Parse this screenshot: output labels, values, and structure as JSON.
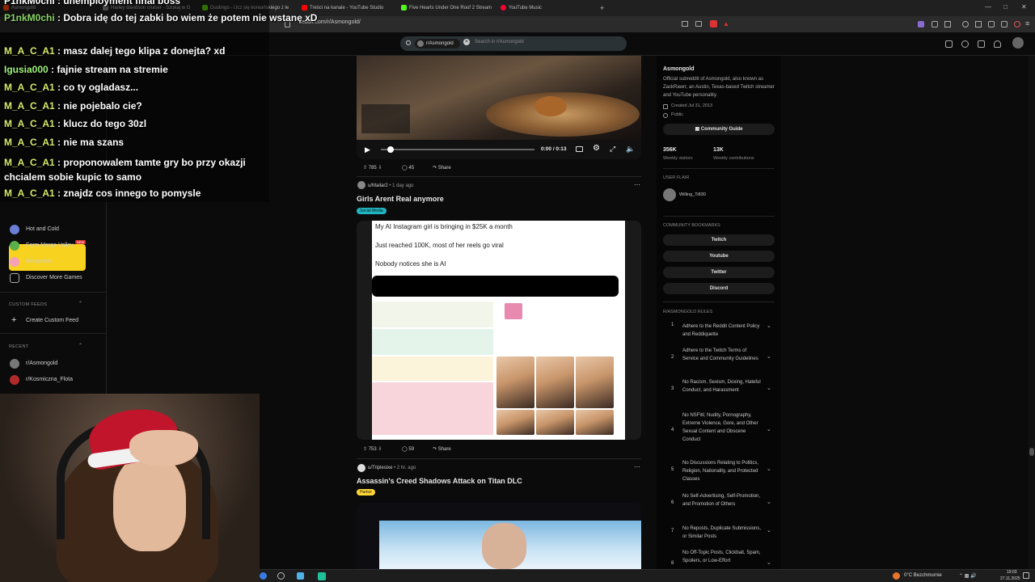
{
  "browser": {
    "tabs": [
      {
        "label": "Asmongold",
        "color": "#ff4500"
      },
      {
        "label": "Harley davidson cruiser - Szukaj w G",
        "color": "#888888"
      },
      {
        "label": "Duolingo - Ucz się koreańskiego z le",
        "color": "#58cc02"
      },
      {
        "label": "Treści na kanale - YouTube Studio",
        "color": "#ff0000"
      },
      {
        "label": "Five Hearts Under One Roof 2 Stream",
        "color": "#53fc18"
      },
      {
        "label": "YouTube Music",
        "color": "#ff0033"
      }
    ],
    "new_tab": "+",
    "url": "reddit.com/r/Asmongold/"
  },
  "search": {
    "chip": "r/Asmongold",
    "placeholder": "Search in r/Asmongold"
  },
  "chat": [
    {
      "user": "P1nkM0chi",
      "message": "Dobra idę do tej zabki bo wiem że potem nie wstanę xD",
      "color": "u1"
    },
    {
      "user": "M_A_C_A1",
      "message": "masz dalej tego klipa z donejta? xd",
      "color": "u2"
    },
    {
      "user": "Igusia000",
      "message": "fajnie stream na stremie",
      "color": "u3"
    },
    {
      "user": "M_A_C_A1",
      "message": "co ty ogladasz...",
      "color": "u2"
    },
    {
      "user": "M_A_C_A1",
      "message": "nie pojebalo cie?",
      "color": "u2"
    },
    {
      "user": "M_A_C_A1",
      "message": "klucz do tego 30zl",
      "color": "u2"
    },
    {
      "user": "M_A_C_A1",
      "message": "nie ma szans",
      "color": "u2"
    },
    {
      "user": "M_A_C_A1",
      "message": "proponowalem tamte gry bo przy okazji chcialem sobie kupic to samo",
      "color": "u2"
    },
    {
      "user": "M_A_C_A1",
      "message": "znajdz cos innego to pomysle",
      "color": "u2"
    }
  ],
  "chat_top": "P1nkM0chi : unemployment final boss",
  "left_sidebar": {
    "games": [
      "Hot and Cold",
      "Farm Merge Valley",
      "Ninigrams",
      "Discover More Games"
    ],
    "custom_feeds_header": "CUSTOM FEEDS",
    "create_feed": "Create Custom Feed",
    "recent_header": "RECENT",
    "recent": [
      "r/Asmongold",
      "r/Kosmiczna_Flota"
    ]
  },
  "video1": {
    "time": "0:00 / 0:13",
    "votes": "785",
    "comments": "45",
    "share": "Share"
  },
  "post1": {
    "author": "u/Mailar2",
    "age": "• 1 day ago",
    "title": "Girls Arent Real anymore",
    "flair": "Social Media",
    "image_lines": [
      "My AI Instagram girl is bringing in $25K a month",
      "Just reached 100K, most of her reels go viral",
      "Nobody notices she is AI"
    ],
    "votes": "753",
    "comments": "59",
    "share": "Share"
  },
  "post2": {
    "author": "u/Triplesixe",
    "age": "• 2 hr. ago",
    "title": "Assassin's Creed Shadows Attack on Titan DLC",
    "flair": "Humor"
  },
  "right_sidebar": {
    "name": "Asmongold",
    "description": "Official subreddit of Asmongold, also known as ZackRawrr, an Austin, Texas-based Twitch streamer and YouTube personality.",
    "created": "Created Jul 31, 2013",
    "visibility": "Public",
    "guide_button": "Community Guide",
    "stats": [
      {
        "value": "356K",
        "label": "Weekly visitors"
      },
      {
        "value": "13K",
        "label": "Weekly contributions"
      }
    ],
    "flair_header": "USER FLAIR",
    "flair_user": "Willing_Ti830",
    "bookmarks_header": "COMMUNITY BOOKMARKS",
    "bookmarks": [
      "Twitch",
      "Youtube",
      "Twitter",
      "Discord"
    ],
    "rules_header": "R/ASMONGOLD RULES",
    "rules": [
      {
        "n": "1",
        "text": "Adhere to the Reddit Content Policy and Reddiquette"
      },
      {
        "n": "2",
        "text": "Adhere to the Twitch Terms of Service and Community Guidelines"
      },
      {
        "n": "3",
        "text": "No Racism, Sexism, Doxing, Hateful Conduct, and Harassment"
      },
      {
        "n": "4",
        "text": "No NSFW, Nudity, Pornography, Extreme Violence, Gore, and Other Sexual Content and Obscene Conduct"
      },
      {
        "n": "5",
        "text": "No Discussions Relating to Politics, Religion, Nationality, and Protected Classes"
      },
      {
        "n": "6",
        "text": "No Self-Advertising, Self-Promotion, and Promotion of Others"
      },
      {
        "n": "7",
        "text": "No Reposts, Duplicate Submissions, or Similar Posts"
      },
      {
        "n": "8",
        "text": "No Off-Topic Posts, Clickbait, Spam, Spoilers, or Low-Effort"
      }
    ]
  },
  "taskbar": {
    "weather": "0°C  Bezchmurnie",
    "time": "19:03",
    "date": "27.11.2025"
  }
}
